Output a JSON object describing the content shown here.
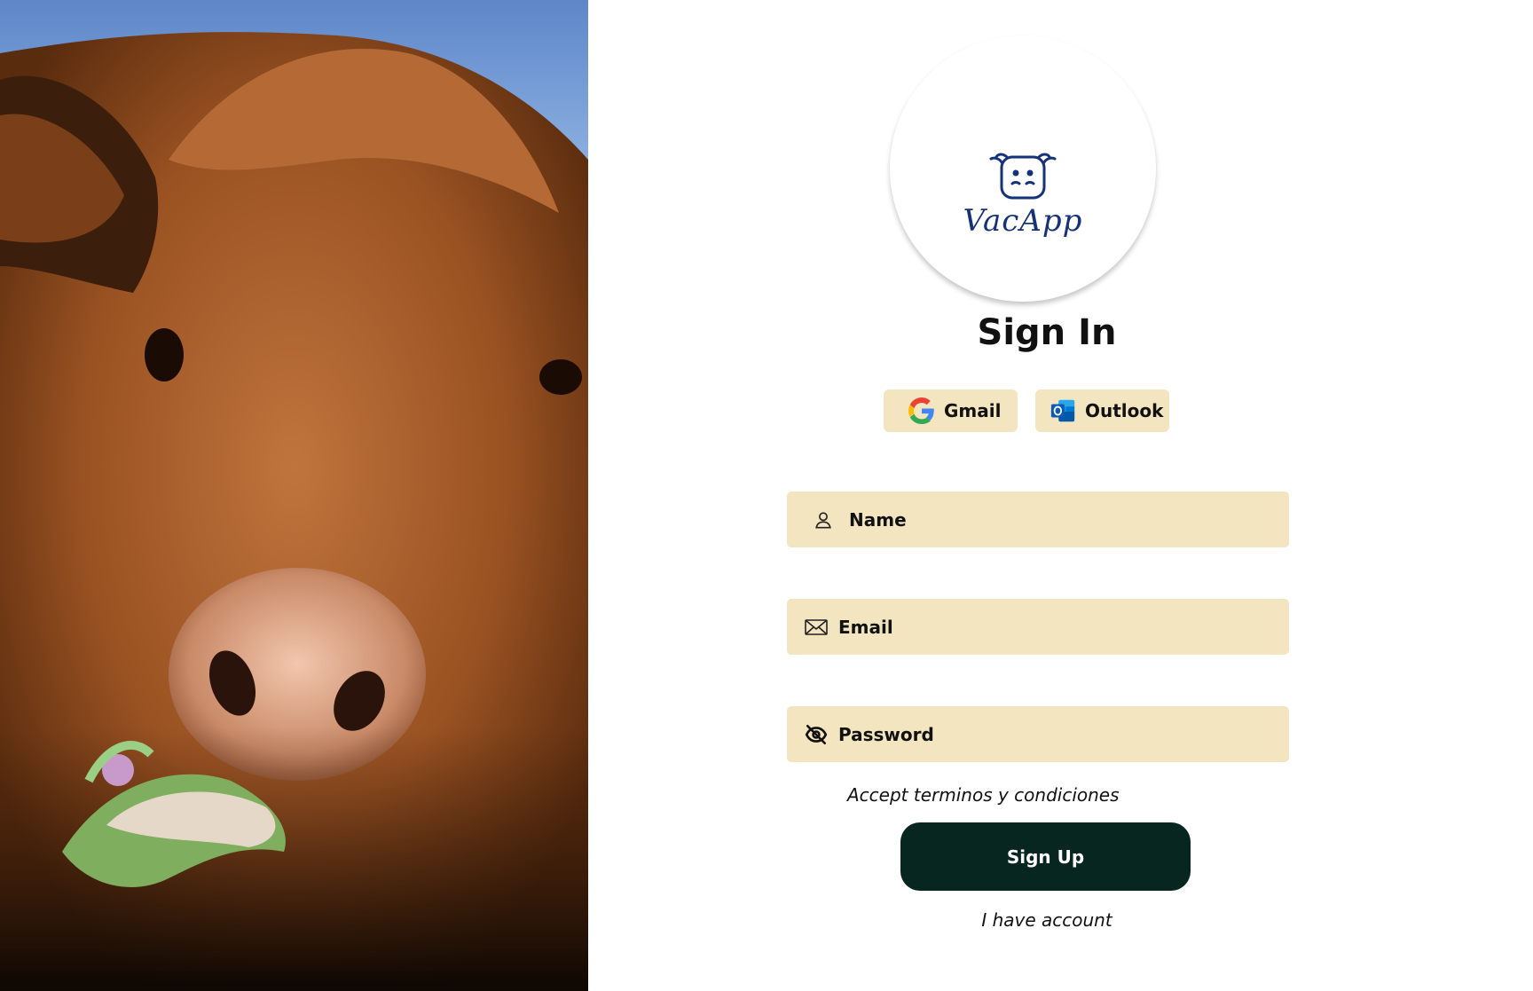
{
  "hero": {
    "image": "cow-photo",
    "description_icon": "cow-icon"
  },
  "logo": {
    "text": "VacApp",
    "icon": "cow-face-icon",
    "color": "#15317a"
  },
  "title": "Sign In",
  "oauth": {
    "gmail": {
      "label": "Gmail",
      "icon": "google-icon"
    },
    "outlook": {
      "label": "Outlook",
      "icon": "outlook-icon"
    }
  },
  "form": {
    "name": {
      "placeholder": "Name",
      "icon": "user-icon"
    },
    "email": {
      "placeholder": "Email",
      "icon": "envelope-icon"
    },
    "password": {
      "placeholder": "Password",
      "icon": "eye-off-icon"
    }
  },
  "terms_label": "Accept terminos y condiciones",
  "signup_label": "Sign Up",
  "have_account_label": "I have account",
  "colors": {
    "field_bg": "#f4e5c1",
    "button_bg": "#06261f",
    "button_text": "#ffffff"
  }
}
